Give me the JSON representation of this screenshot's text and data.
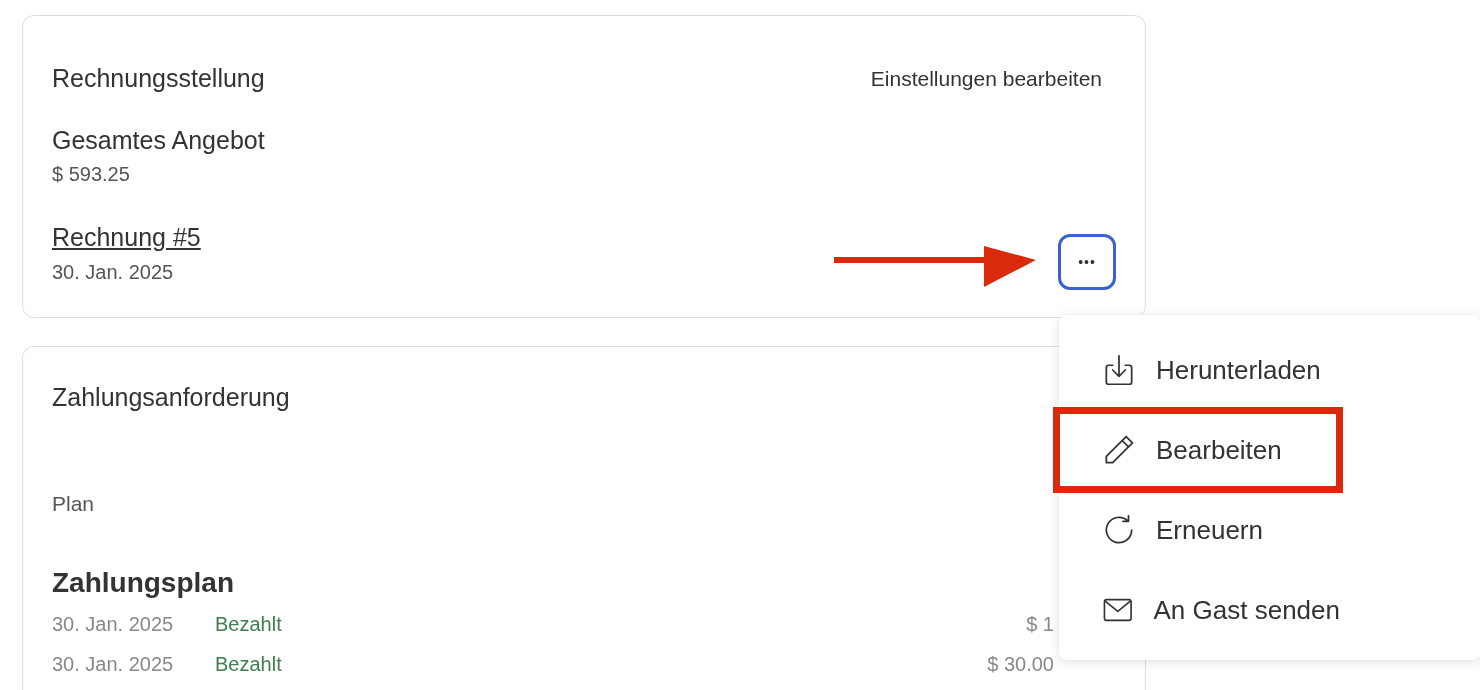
{
  "billing_card": {
    "title": "Rechnungsstellung",
    "edit_link": "Einstellungen bearbeiten",
    "total_label": "Gesamtes Angebot",
    "total_value": "$ 593.25",
    "invoice_link": "Rechnung #5",
    "invoice_date": "30. Jan. 2025",
    "more_button": "•••"
  },
  "payment_card": {
    "title": "Zahlungsanforderung",
    "plan_label": "Plan",
    "plan_title": "Zahlungsplan",
    "rows": [
      {
        "date": "30. Jan. 2025",
        "status": "Bezahlt",
        "amount": "$ 1"
      },
      {
        "date": "30. Jan. 2025",
        "status": "Bezahlt",
        "amount": "$ 30.00"
      }
    ]
  },
  "menu": {
    "items": [
      {
        "kind": "download",
        "label": "Herunterladen",
        "highlighted": false
      },
      {
        "kind": "edit",
        "label": "Bearbeiten",
        "highlighted": true
      },
      {
        "kind": "renew",
        "label": "Erneuern",
        "highlighted": false
      },
      {
        "kind": "send",
        "label": "An Gast senden",
        "highlighted": false
      }
    ]
  }
}
